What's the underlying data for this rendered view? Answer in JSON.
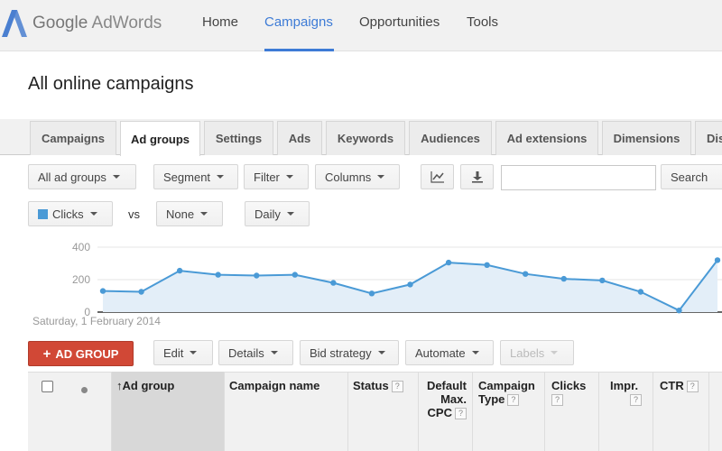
{
  "header": {
    "logo_google": "Google",
    "logo_product": "AdWords",
    "nav": [
      "Home",
      "Campaigns",
      "Opportunities",
      "Tools"
    ],
    "active_nav": "Campaigns"
  },
  "page_title": "All online campaigns",
  "tabs": [
    "Campaigns",
    "Ad groups",
    "Settings",
    "Ads",
    "Keywords",
    "Audiences",
    "Ad extensions",
    "Dimensions",
    "Dis"
  ],
  "active_tab": "Ad groups",
  "toolbar": {
    "filter_scope": "All ad groups",
    "segment": "Segment",
    "filter": "Filter",
    "columns": "Columns",
    "search_value": "",
    "search_label": "Search"
  },
  "chart_controls": {
    "metric1": "Clicks",
    "vs": "vs",
    "metric2": "None",
    "interval": "Daily"
  },
  "chart_data": {
    "type": "line",
    "title": "",
    "start_label": "Saturday, 1 February 2014",
    "ylim": [
      0,
      400
    ],
    "y_ticks": [
      "400",
      "200",
      "0"
    ],
    "series": [
      {
        "values": [
          130,
          125,
          255,
          230,
          225,
          230,
          180,
          115,
          170,
          305,
          290,
          235,
          205,
          195,
          125,
          10,
          320
        ]
      }
    ],
    "colors": {
      "line": "#4a9ad6",
      "fill": "#e3eef8"
    }
  },
  "actions": {
    "add": "AD GROUP",
    "edit": "Edit",
    "details": "Details",
    "bid_strategy": "Bid strategy",
    "automate": "Automate",
    "labels": "Labels"
  },
  "table": {
    "headers": {
      "ad_group": "Ad group",
      "campaign_name": "Campaign name",
      "status": "Status",
      "default_max_cpc_1": "Default",
      "default_max_cpc_2": "Max.",
      "default_max_cpc_3": "CPC",
      "campaign_type_1": "Campaign",
      "campaign_type_2": "Type",
      "clicks": "Clicks",
      "impr": "Impr.",
      "ctr": "CTR"
    },
    "help_glyph": "?"
  },
  "colors": {
    "accent": "#3d7bd6",
    "add_button": "#d14836"
  }
}
